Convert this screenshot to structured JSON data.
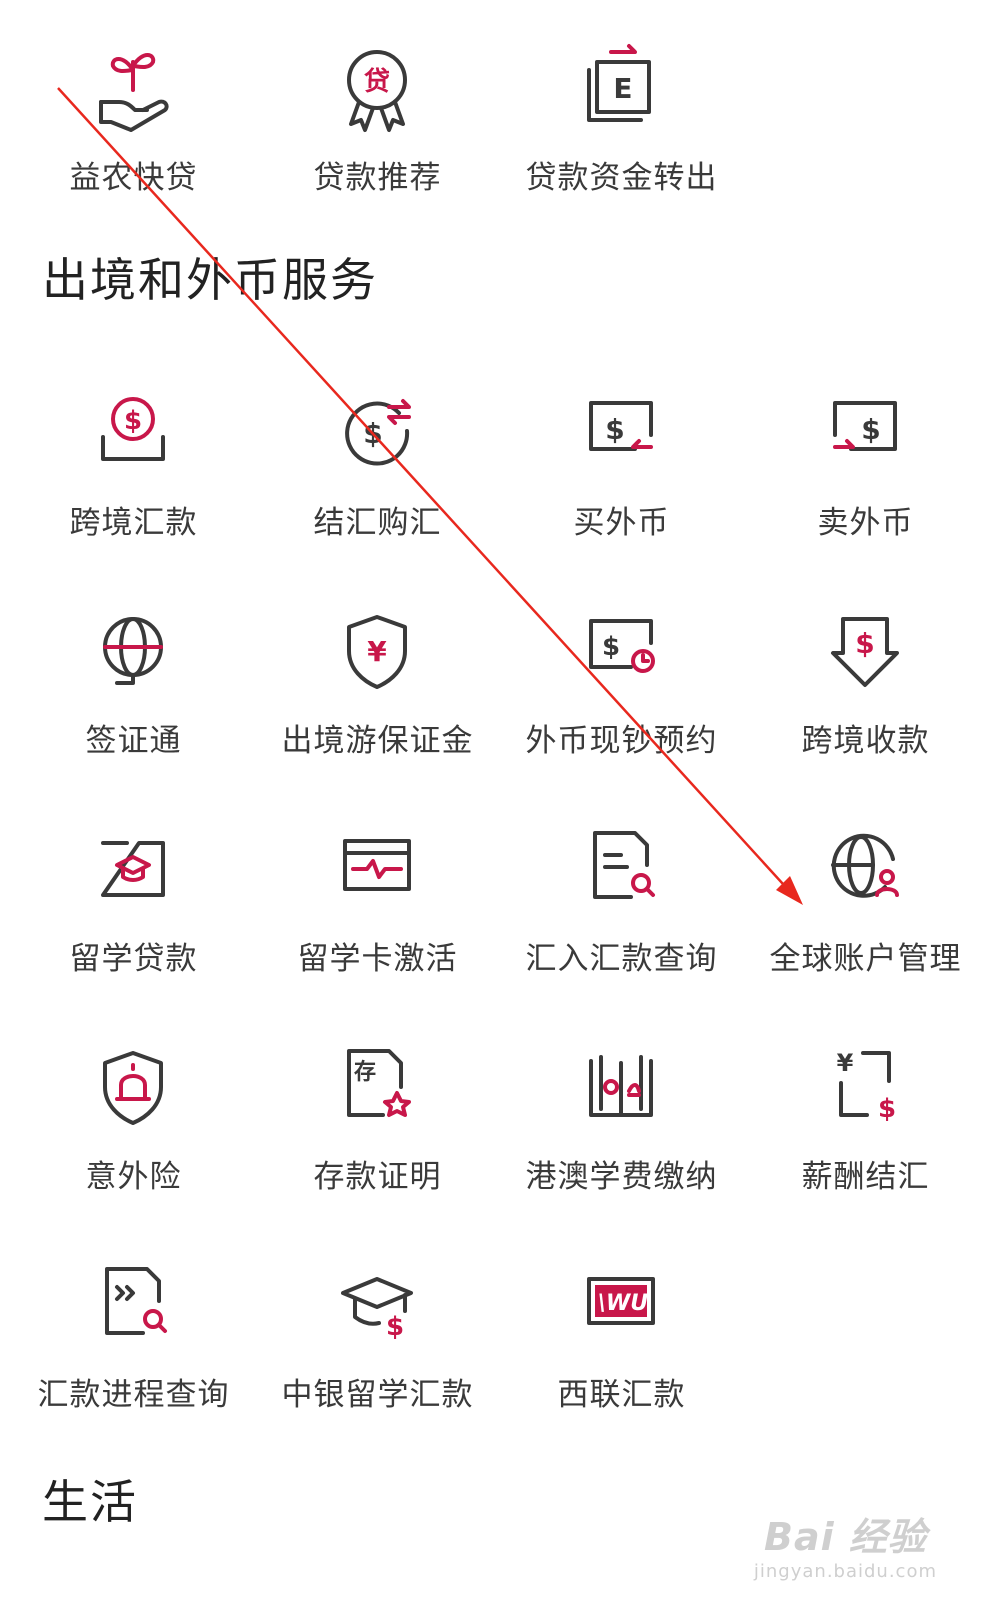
{
  "loan_row": {
    "items": [
      {
        "label": "益农快贷",
        "icon": "sprout-hand-icon"
      },
      {
        "label": "贷款推荐",
        "icon": "loan-badge-icon"
      },
      {
        "label": "贷款资金转出",
        "icon": "e-transfer-icon"
      }
    ]
  },
  "section_forex": {
    "title": "出境和外币服务",
    "items": [
      {
        "label": "跨境汇款",
        "icon": "dollar-coin-tray-icon"
      },
      {
        "label": "结汇购汇",
        "icon": "dollar-exchange-icon"
      },
      {
        "label": "买外币",
        "icon": "dollar-buy-icon"
      },
      {
        "label": "卖外币",
        "icon": "dollar-sell-icon"
      },
      {
        "label": "签证通",
        "icon": "globe-visa-icon"
      },
      {
        "label": "出境游保证金",
        "icon": "yuan-shield-icon"
      },
      {
        "label": "外币现钞预约",
        "icon": "dollar-clock-icon"
      },
      {
        "label": "跨境收款",
        "icon": "dollar-receive-icon"
      },
      {
        "label": "留学贷款",
        "icon": "graduation-card-icon"
      },
      {
        "label": "留学卡激活",
        "icon": "card-pulse-icon"
      },
      {
        "label": "汇入汇款查询",
        "icon": "document-search-icon"
      },
      {
        "label": "全球账户管理",
        "icon": "globe-user-icon"
      },
      {
        "label": "意外险",
        "icon": "alarm-shield-icon"
      },
      {
        "label": "存款证明",
        "icon": "deposit-certificate-icon"
      },
      {
        "label": "港澳学费缴纳",
        "icon": "hk-macau-book-icon"
      },
      {
        "label": "薪酬结汇",
        "icon": "salary-exchange-icon"
      },
      {
        "label": "汇款进程查询",
        "icon": "code-document-search-icon"
      },
      {
        "label": "中银留学汇款",
        "icon": "graduation-cap-dollar-icon"
      },
      {
        "label": "西联汇款",
        "icon": "western-union-icon"
      }
    ]
  },
  "section_life": {
    "title": "生活"
  },
  "watermark": {
    "logo": "Bai 经验",
    "url": "jingyan.baidu.com"
  },
  "colors": {
    "accent": "#c8174a",
    "icon_stroke": "#3a3a3a",
    "annotation_arrow": "#e8281e"
  }
}
